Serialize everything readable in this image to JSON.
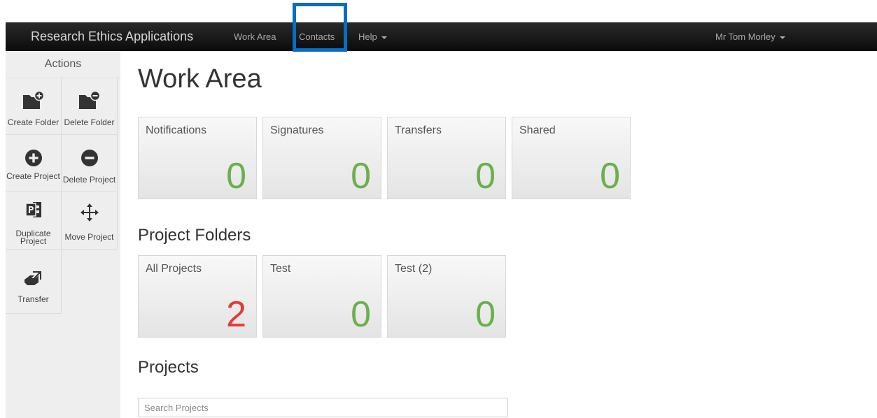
{
  "navbar": {
    "brand": "Research Ethics Applications",
    "items": [
      {
        "label": "Work Area"
      },
      {
        "label": "Contacts"
      },
      {
        "label": "Help"
      }
    ],
    "user": "Mr Tom Morley"
  },
  "sidebar": {
    "title": "Actions",
    "actions": [
      {
        "label": "Create Folder",
        "icon": "folder-plus-icon"
      },
      {
        "label": "Delete Folder",
        "icon": "folder-minus-icon"
      },
      {
        "label": "Create Project",
        "icon": "plus-circle-icon"
      },
      {
        "label": "Delete Project",
        "icon": "minus-circle-icon"
      },
      {
        "label": "Duplicate Project",
        "icon": "duplicate-icon"
      },
      {
        "label": "Move Project",
        "icon": "move-arrows-icon"
      },
      {
        "label": "Transfer",
        "icon": "transfer-icon"
      }
    ]
  },
  "main": {
    "title": "Work Area",
    "status_tiles": [
      {
        "label": "Notifications",
        "value": "0"
      },
      {
        "label": "Signatures",
        "value": "0"
      },
      {
        "label": "Transfers",
        "value": "0"
      },
      {
        "label": "Shared",
        "value": "0"
      }
    ],
    "folders_title": "Project Folders",
    "folders": [
      {
        "label": "All Projects",
        "value": "2"
      },
      {
        "label": "Test",
        "value": "0"
      },
      {
        "label": "Test (2)",
        "value": "0"
      }
    ],
    "projects_title": "Projects",
    "search_placeholder": "Search Projects"
  },
  "colors": {
    "navbar": "#1c1c1c",
    "highlight": "#0a6cc2",
    "zero_value": "#6ab04c",
    "nonzero_value": "#e53935"
  }
}
